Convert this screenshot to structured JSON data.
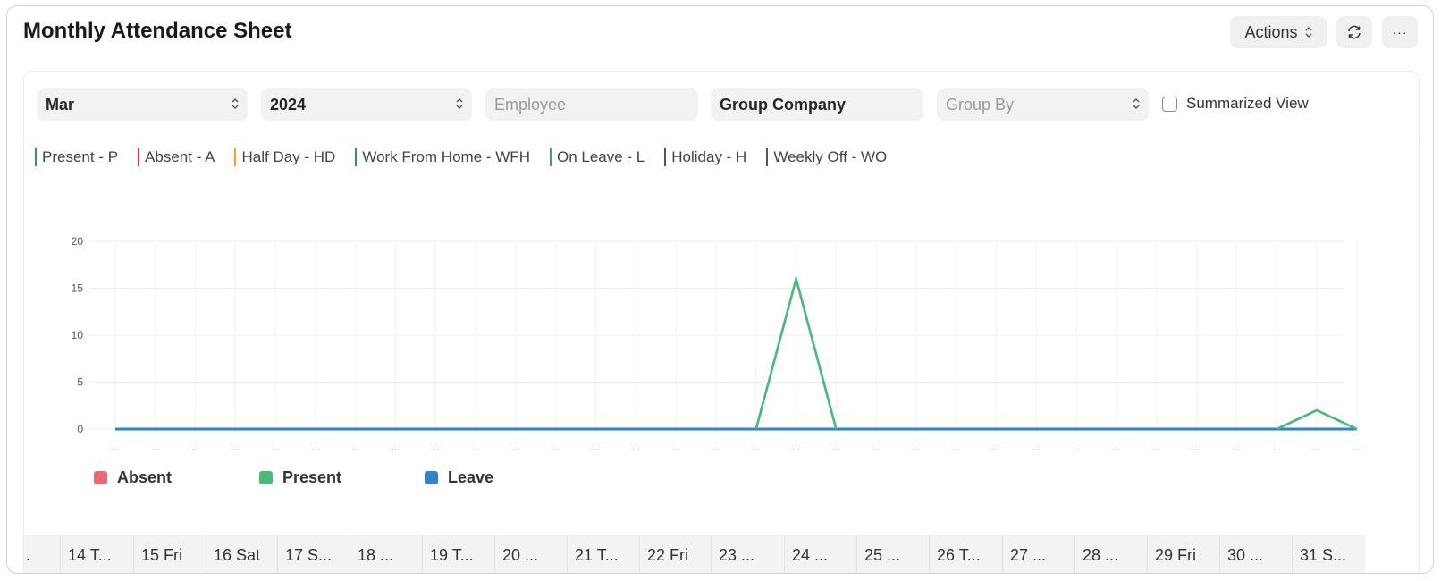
{
  "page": {
    "title": "Monthly Attendance Sheet"
  },
  "toolbar": {
    "actions_label": "Actions",
    "refresh_icon": "refresh-icon",
    "more_label": "···"
  },
  "filters": {
    "month": "Mar",
    "year": "2024",
    "employee_placeholder": "Employee",
    "company": "Group Company",
    "group_by_placeholder": "Group By",
    "summarized_view_label": "Summarized View",
    "summarized_view_checked": false
  },
  "status_keys": [
    {
      "label": "Present - P",
      "color": "#2e9e44"
    },
    {
      "label": "Absent - A",
      "color": "#e03636"
    },
    {
      "label": "Half Day - HD",
      "color": "#f5a623"
    },
    {
      "label": "Work From Home - WFH",
      "color": "#2e9e44"
    },
    {
      "label": "On Leave - L",
      "color": "#3b8fe0"
    },
    {
      "label": "Holiday - H",
      "color": "#555555"
    },
    {
      "label": "Weekly Off - WO",
      "color": "#555555"
    }
  ],
  "chart_data": {
    "type": "line",
    "x": [
      "...",
      "...",
      "...",
      "...",
      "...",
      "...",
      "...",
      "...",
      "...",
      "...",
      "...",
      "...",
      "...",
      "...",
      "...",
      "...",
      "...",
      "...",
      "...",
      "...",
      "...",
      "...",
      "...",
      "...",
      "...",
      "...",
      "...",
      "...",
      "...",
      "...",
      "...",
      "..."
    ],
    "ylim": [
      0,
      20
    ],
    "yticks": [
      0,
      5,
      10,
      15,
      20
    ],
    "grid": true,
    "legend_placement": "bottom-left",
    "series": [
      {
        "name": "Absent",
        "color": "#f0686f",
        "values": [
          0,
          0,
          0,
          0,
          0,
          0,
          0,
          0,
          0,
          0,
          0,
          0,
          0,
          0,
          0,
          0,
          0,
          0,
          0,
          0,
          0,
          0,
          0,
          0,
          0,
          0,
          0,
          0,
          0,
          0,
          0,
          0
        ]
      },
      {
        "name": "Present",
        "color": "#48bb78",
        "values": [
          0,
          0,
          0,
          0,
          0,
          0,
          0,
          0,
          0,
          0,
          0,
          0,
          0,
          0,
          0,
          0,
          0,
          16,
          0,
          0,
          0,
          0,
          0,
          0,
          0,
          0,
          0,
          0,
          0,
          0,
          2,
          0
        ]
      },
      {
        "name": "Leave",
        "color": "#3182ce",
        "values": [
          0,
          0,
          0,
          0,
          0,
          0,
          0,
          0,
          0,
          0,
          0,
          0,
          0,
          0,
          0,
          0,
          0,
          0,
          0,
          0,
          0,
          0,
          0,
          0,
          0,
          0,
          0,
          0,
          0,
          0,
          0,
          0
        ]
      }
    ]
  },
  "table": {
    "columns": [
      ".",
      "14 T...",
      "15 Fri",
      "16 Sat",
      "17 S...",
      "18 ...",
      "19 T...",
      "20 ...",
      "21 T...",
      "22 Fri",
      "23 ...",
      "24 ...",
      "25 ...",
      "26 T...",
      "27 ...",
      "28 ...",
      "29 Fri",
      "30 ...",
      "31 S..."
    ]
  }
}
